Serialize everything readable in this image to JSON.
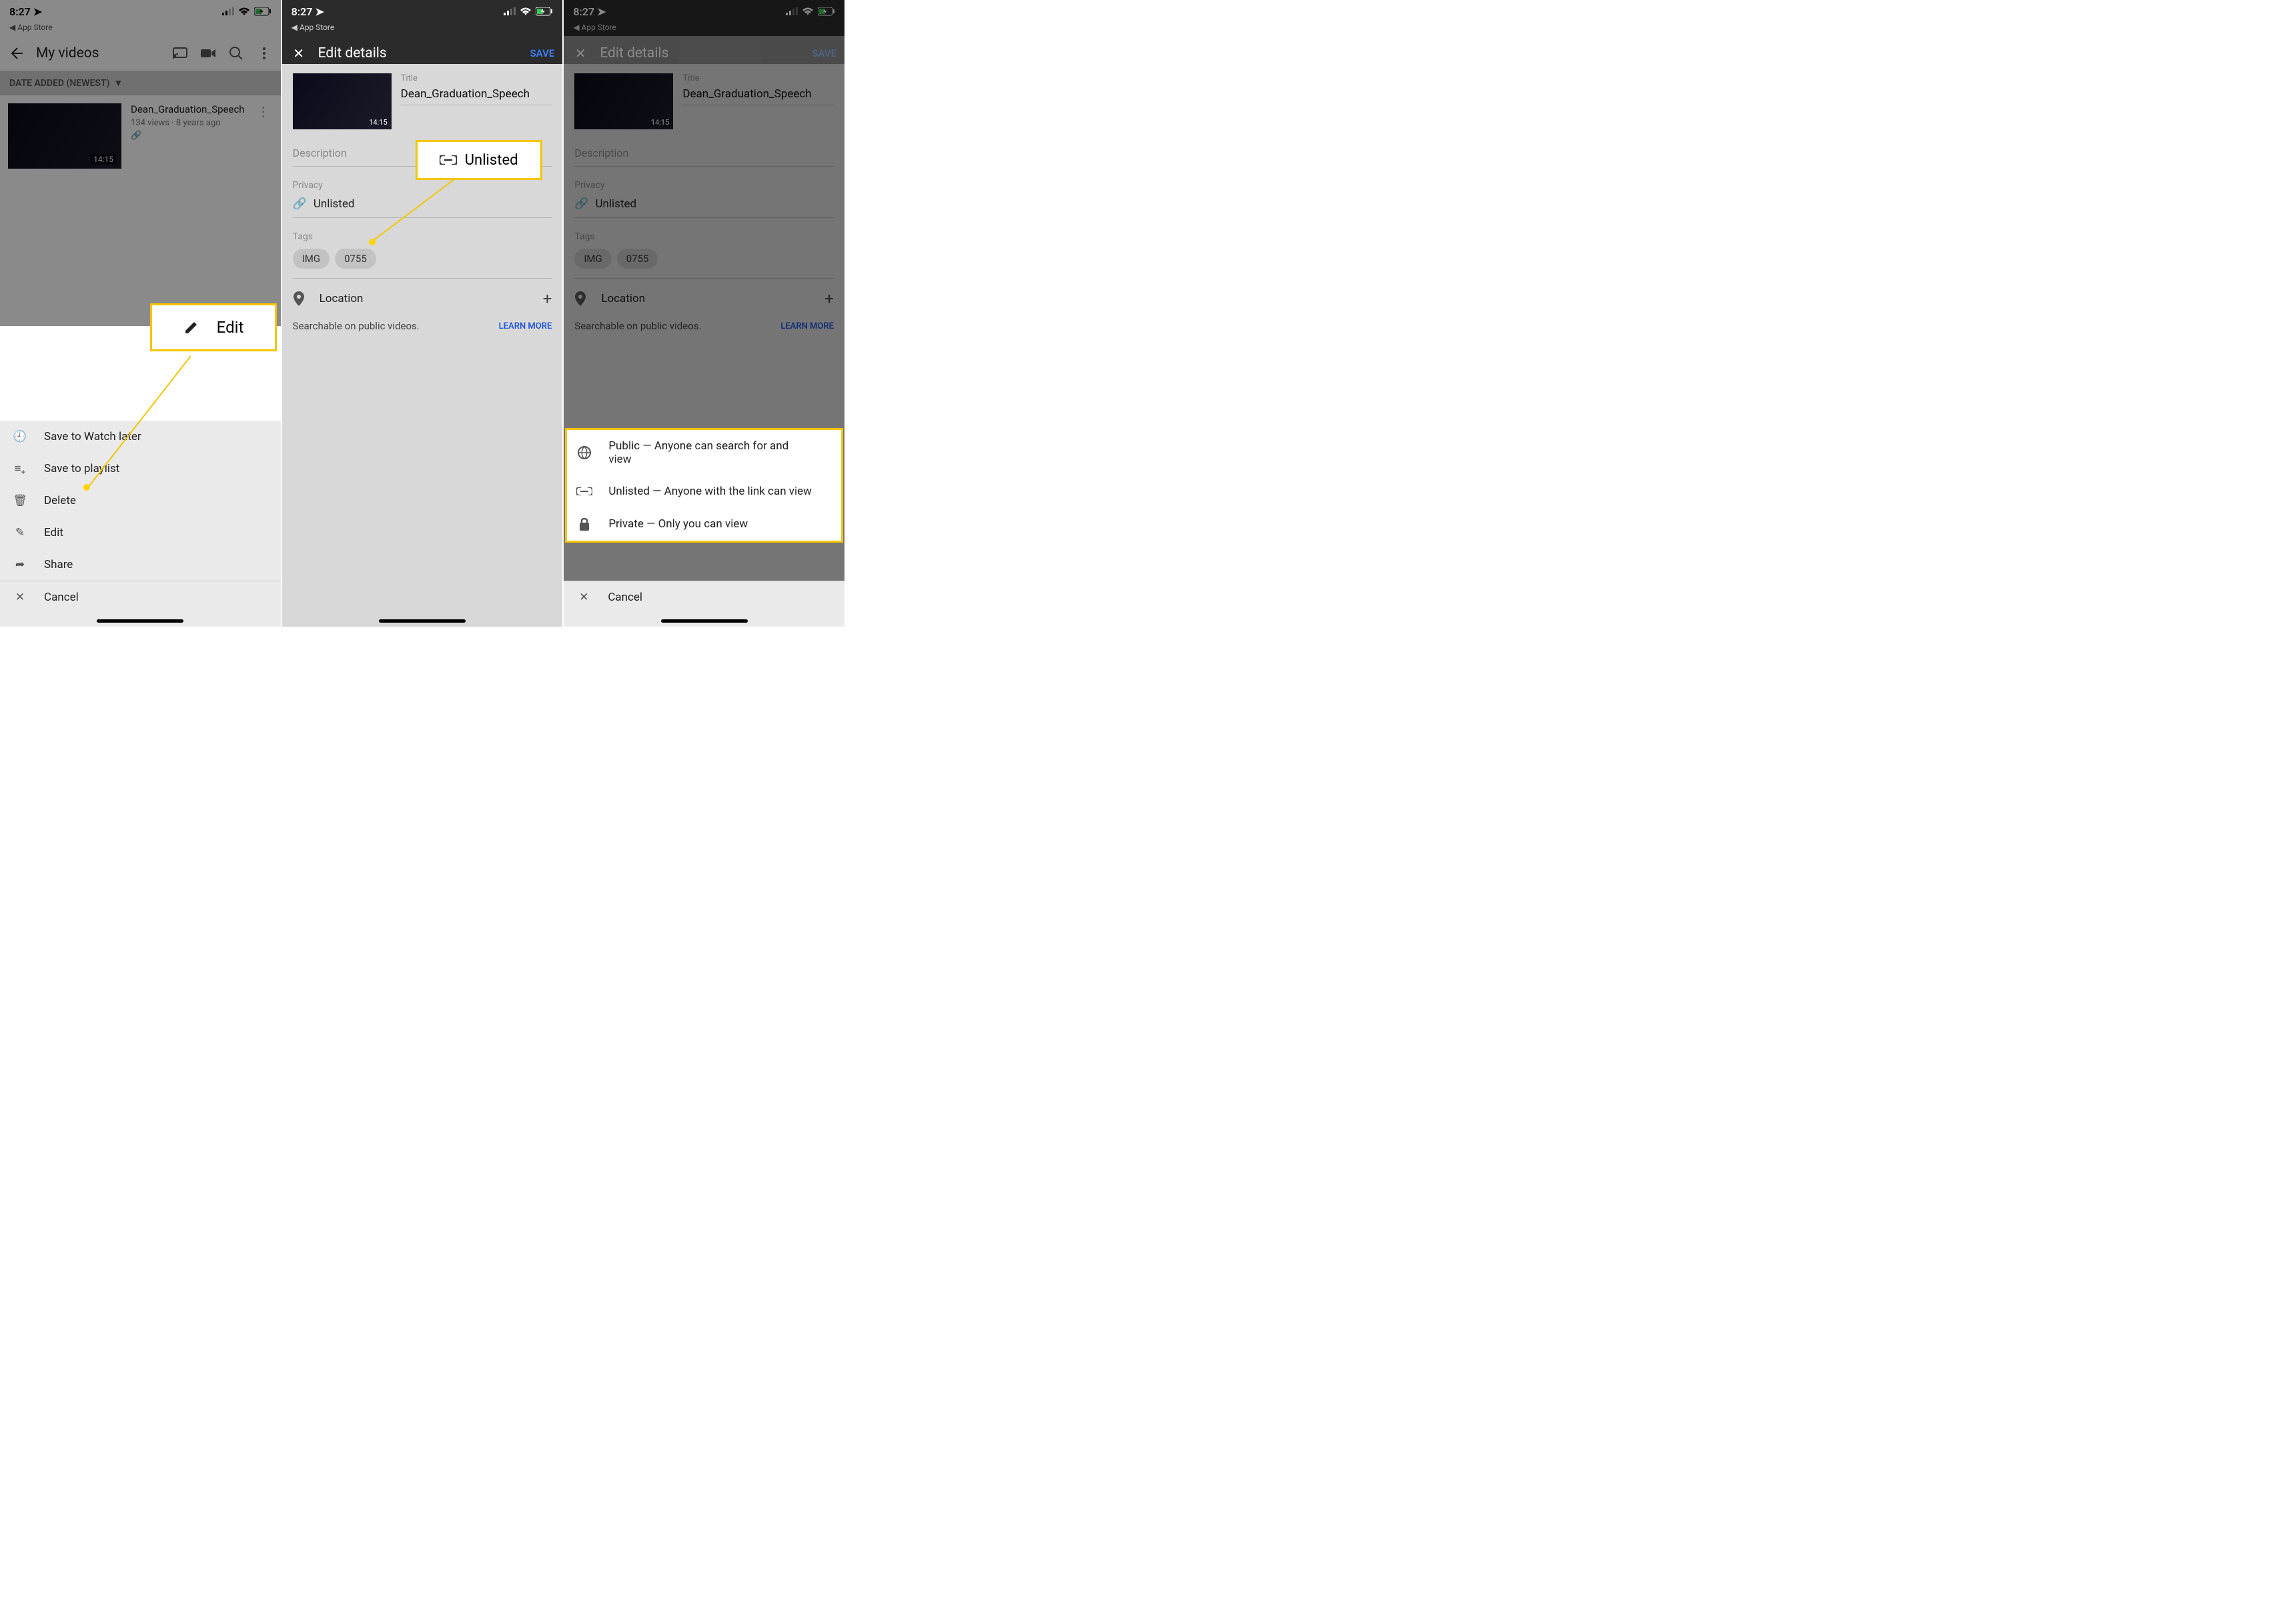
{
  "status": {
    "time": "8:27",
    "back_app": "App Store"
  },
  "panel1": {
    "title": "My videos",
    "sort": "DATE ADDED (NEWEST)",
    "video": {
      "title": "Dean_Graduation_Speech",
      "views": "134 views",
      "age": "8 years ago",
      "duration": "14:15"
    },
    "sheet": {
      "watch_later": "Save to Watch later",
      "playlist": "Save to playlist",
      "delete": "Delete",
      "edit": "Edit",
      "share": "Share",
      "cancel": "Cancel"
    },
    "callout_edit": "Edit"
  },
  "panel2": {
    "header": "Edit details",
    "save": "SAVE",
    "title_lbl": "Title",
    "title_val": "Dean_Graduation_Speech",
    "duration": "14:15",
    "description_lbl": "Description",
    "privacy_lbl": "Privacy",
    "privacy_val": "Unlisted",
    "tags_lbl": "Tags",
    "tags": [
      "IMG",
      "0755"
    ],
    "location_lbl": "Location",
    "searchable": "Searchable on public videos.",
    "learn_more": "LEARN MORE",
    "callout_unlisted": "Unlisted"
  },
  "panel3": {
    "header": "Edit details",
    "save": "SAVE",
    "title_lbl": "Title",
    "title_val": "Dean_Graduation_Speech",
    "duration": "14:15",
    "description_lbl": "Description",
    "privacy_lbl": "Privacy",
    "privacy_val": "Unlisted",
    "tags_lbl": "Tags",
    "tags": [
      "IMG",
      "0755"
    ],
    "location_lbl": "Location",
    "searchable": "Searchable on public videos.",
    "learn_more": "LEARN MORE",
    "options": {
      "public": "Public — Anyone can search for and view",
      "unlisted": "Unlisted — Anyone with the link can view",
      "private": "Private — Only you can view"
    },
    "cancel": "Cancel"
  }
}
